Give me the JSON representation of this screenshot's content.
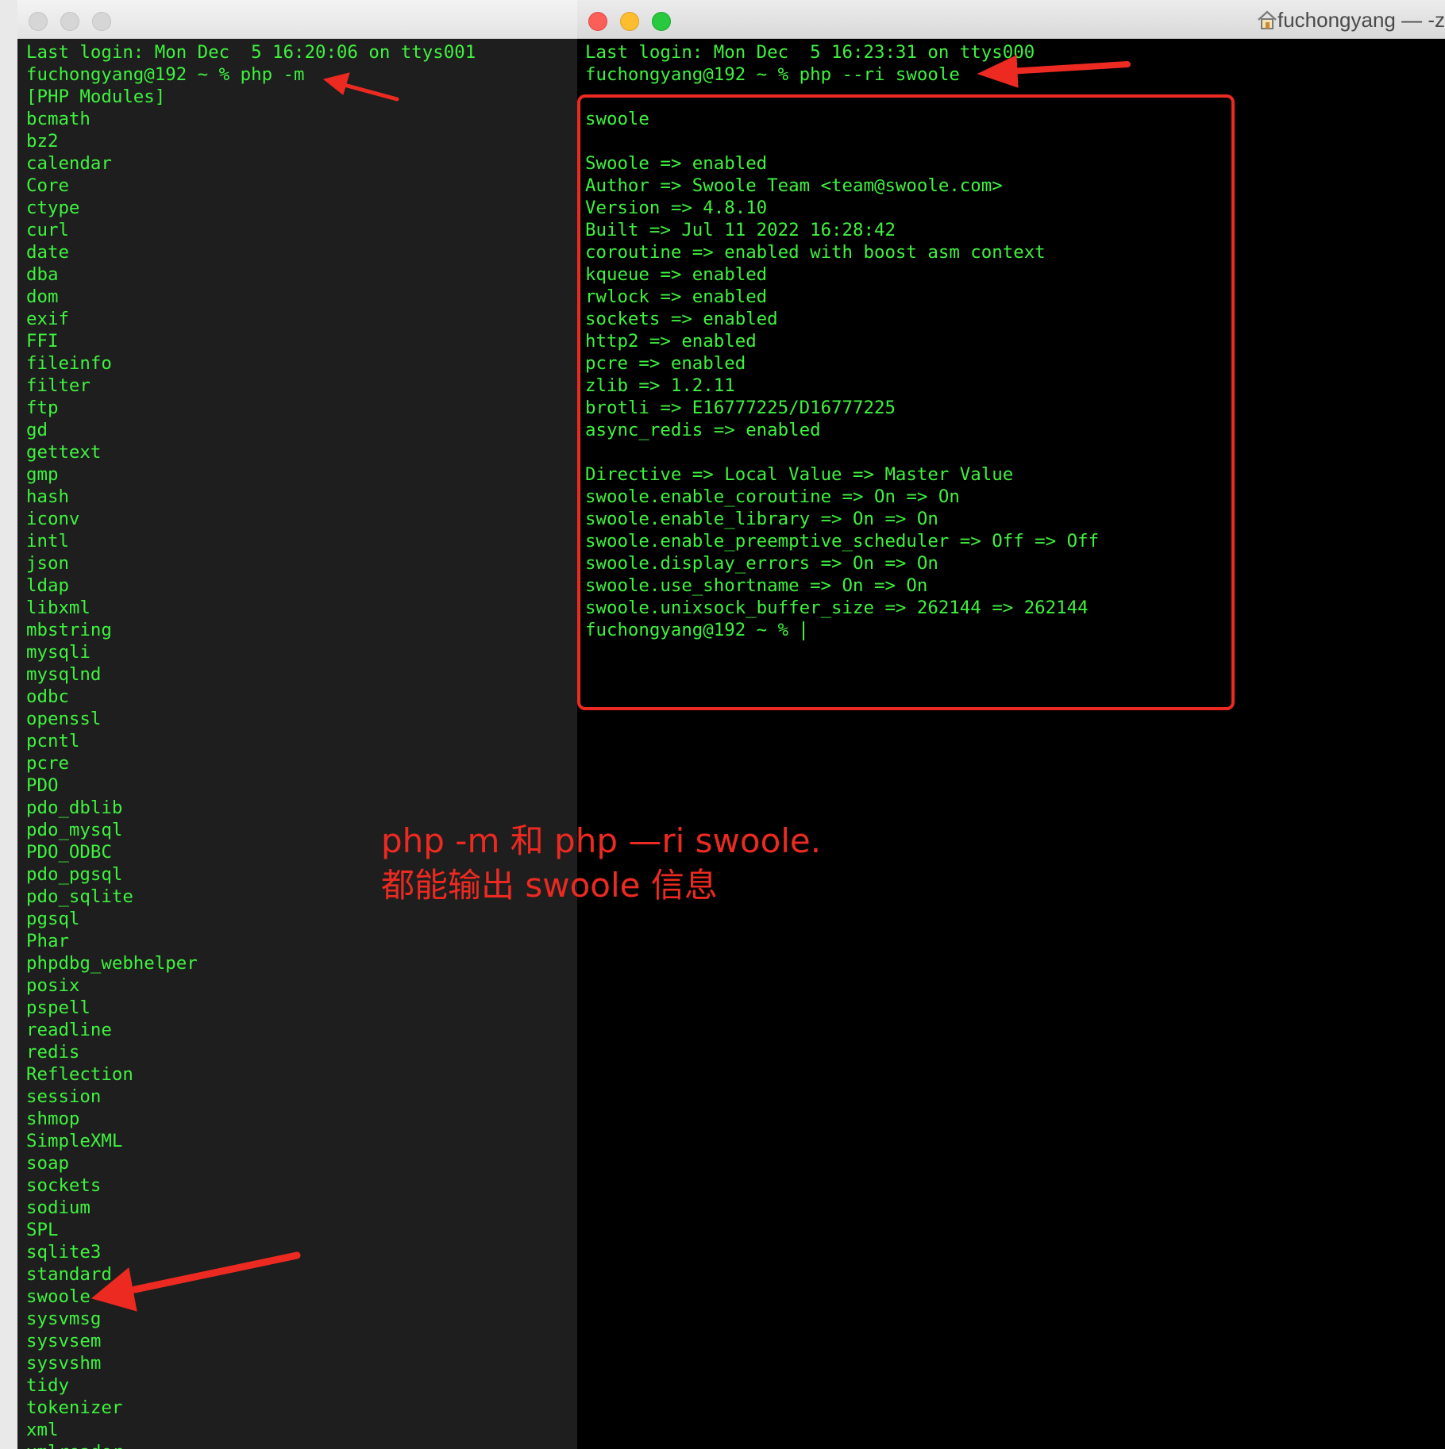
{
  "left_terminal": {
    "lines": [
      "Last login: Mon Dec  5 16:20:06 on ttys001",
      "fuchongyang@192 ~ % php -m",
      "[PHP Modules]",
      "bcmath",
      "bz2",
      "calendar",
      "Core",
      "ctype",
      "curl",
      "date",
      "dba",
      "dom",
      "exif",
      "FFI",
      "fileinfo",
      "filter",
      "ftp",
      "gd",
      "gettext",
      "gmp",
      "hash",
      "iconv",
      "intl",
      "json",
      "ldap",
      "libxml",
      "mbstring",
      "mysqli",
      "mysqlnd",
      "odbc",
      "openssl",
      "pcntl",
      "pcre",
      "PDO",
      "pdo_dblib",
      "pdo_mysql",
      "PDO_ODBC",
      "pdo_pgsql",
      "pdo_sqlite",
      "pgsql",
      "Phar",
      "phpdbg_webhelper",
      "posix",
      "pspell",
      "readline",
      "redis",
      "Reflection",
      "session",
      "shmop",
      "SimpleXML",
      "soap",
      "sockets",
      "sodium",
      "SPL",
      "sqlite3",
      "standard",
      "swoole",
      "sysvmsg",
      "sysvsem",
      "sysvshm",
      "tidy",
      "tokenizer",
      "xml",
      "xmlreader"
    ]
  },
  "right_terminal": {
    "title": "fuchongyang — -z",
    "lines": [
      "Last login: Mon Dec  5 16:23:31 on ttys000",
      "fuchongyang@192 ~ % php --ri swoole",
      "",
      "swoole",
      "",
      "Swoole => enabled",
      "Author => Swoole Team <team@swoole.com>",
      "Version => 4.8.10",
      "Built => Jul 11 2022 16:28:42",
      "coroutine => enabled with boost asm context",
      "kqueue => enabled",
      "rwlock => enabled",
      "sockets => enabled",
      "http2 => enabled",
      "pcre => enabled",
      "zlib => 1.2.11",
      "brotli => E16777225/D16777225",
      "async_redis => enabled",
      "",
      "Directive => Local Value => Master Value",
      "swoole.enable_coroutine => On => On",
      "swoole.enable_library => On => On",
      "swoole.enable_preemptive_scheduler => Off => Off",
      "swoole.display_errors => On => On",
      "swoole.use_shortname => On => On",
      "swoole.unixsock_buffer_size => 262144 => 262144"
    ],
    "prompt": "fuchongyang@192 ~ % "
  },
  "annotation": {
    "line1": "php -m 和 php —ri swoole.",
    "line2": "都能输出 swoole 信息"
  },
  "colors": {
    "terminal_text": "#3ff23f",
    "annotation_red": "#ec2a21"
  }
}
